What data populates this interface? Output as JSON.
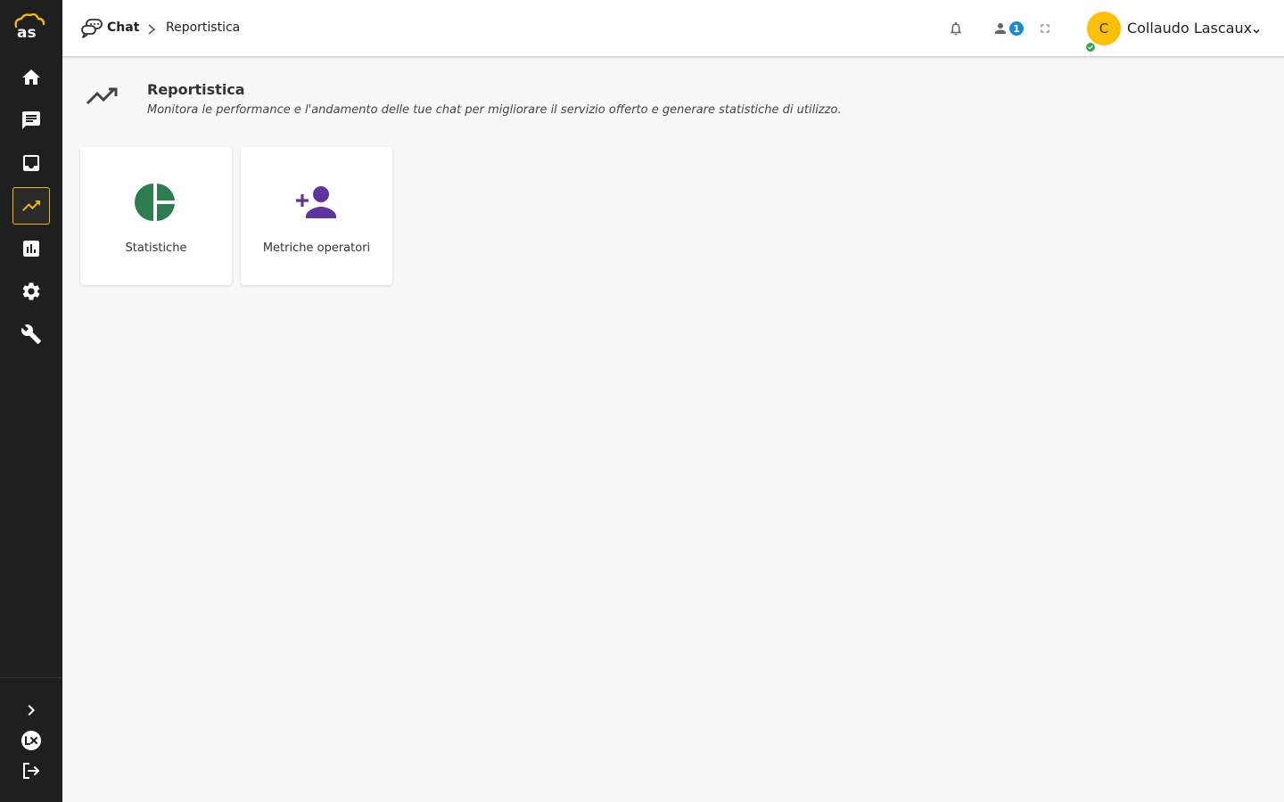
{
  "app": {
    "logo_text": "as"
  },
  "sidebar": {
    "items": [
      {
        "name": "home",
        "icon": "home-icon",
        "active": false
      },
      {
        "name": "chat",
        "icon": "chat-icon",
        "active": false
      },
      {
        "name": "inbox",
        "icon": "inbox-icon",
        "active": false
      },
      {
        "name": "reportistica",
        "icon": "trending-up-icon",
        "active": true
      },
      {
        "name": "analytics",
        "icon": "bar-chart-icon",
        "active": false
      },
      {
        "name": "settings",
        "icon": "gear-icon",
        "active": false
      },
      {
        "name": "tools",
        "icon": "wrench-icon",
        "active": false
      }
    ],
    "bottom": [
      {
        "name": "expand",
        "icon": "chevron-right-icon"
      },
      {
        "name": "lx",
        "icon": "lx-logo-icon"
      },
      {
        "name": "logout",
        "icon": "logout-icon"
      }
    ],
    "accent_color": "#f2b705"
  },
  "topbar": {
    "breadcrumb": {
      "app": "Chat",
      "page": "Reportistica"
    },
    "operators_badge": "1",
    "user": {
      "initial": "C",
      "name": "Collaudo Lascaux",
      "status": "online",
      "avatar_color": "#fbbf07"
    }
  },
  "page": {
    "title": "Reportistica",
    "subtitle": "Monitora le performance e l'andamento delle tue chat per migliorare il servizio offerto e generare statistiche di utilizzo."
  },
  "cards": [
    {
      "label": "Statistiche",
      "icon": "pie-chart-icon",
      "color": "#2e7d4f"
    },
    {
      "label": "Metriche operatori",
      "icon": "person-add-icon",
      "color": "#5e35a0"
    }
  ]
}
